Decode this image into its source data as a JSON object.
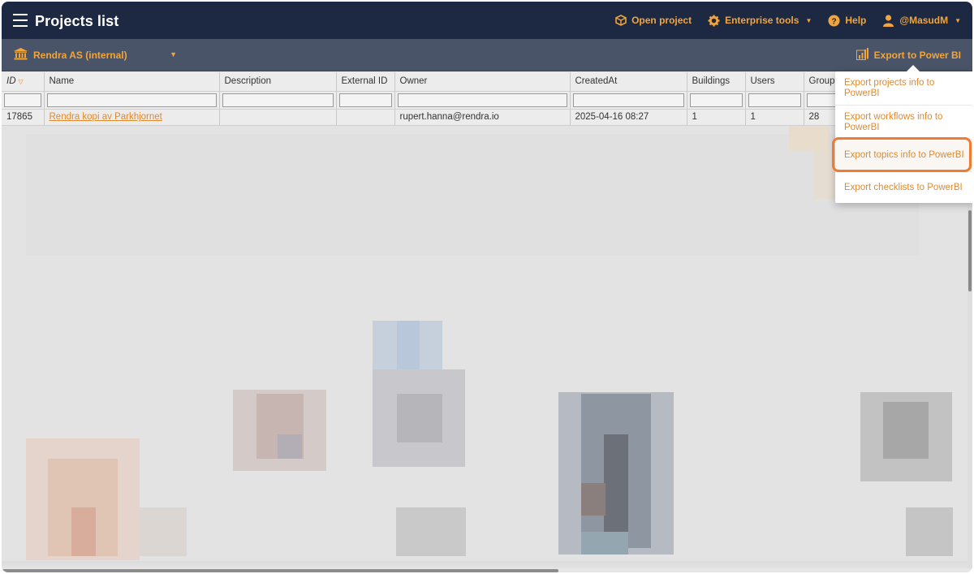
{
  "header": {
    "title": "Projects list",
    "nav": [
      {
        "icon": "cube-icon",
        "label": "Open project",
        "caret": false
      },
      {
        "icon": "gear-icon",
        "label": "Enterprise tools",
        "caret": true
      },
      {
        "icon": "help-icon",
        "label": "Help",
        "caret": false
      },
      {
        "icon": "user-icon",
        "label": "@MasudM",
        "caret": true
      }
    ]
  },
  "orgbar": {
    "org_name": "Rendra AS (internal)",
    "export_label": "Export to Power BI"
  },
  "table": {
    "columns": [
      "ID",
      "Name",
      "Description",
      "External ID",
      "Owner",
      "CreatedAt",
      "Buildings",
      "Users",
      "Groups"
    ],
    "sorted_column": "ID",
    "rows": [
      {
        "id": "17865",
        "name": "Rendra kopi av Parkhjornet",
        "description": "",
        "external_id": "",
        "owner": "rupert.hanna@rendra.io",
        "created_at": "2025-04-16 08:27",
        "buildings": "1",
        "users": "1",
        "groups": "28"
      }
    ]
  },
  "export_menu": {
    "items": [
      "Export projects info to PowerBI",
      "Export workflows info to PowerBI",
      "Export topics info to PowerBI",
      "Export checklists to PowerBI"
    ],
    "highlighted_item": "Export topics info to PowerBI"
  },
  "colors": {
    "accent": "#f2a53a",
    "link": "#e08a2f",
    "topbar": "#1d2942",
    "orgbar": "#4a5468",
    "highlight_ring": "#f07b32"
  }
}
